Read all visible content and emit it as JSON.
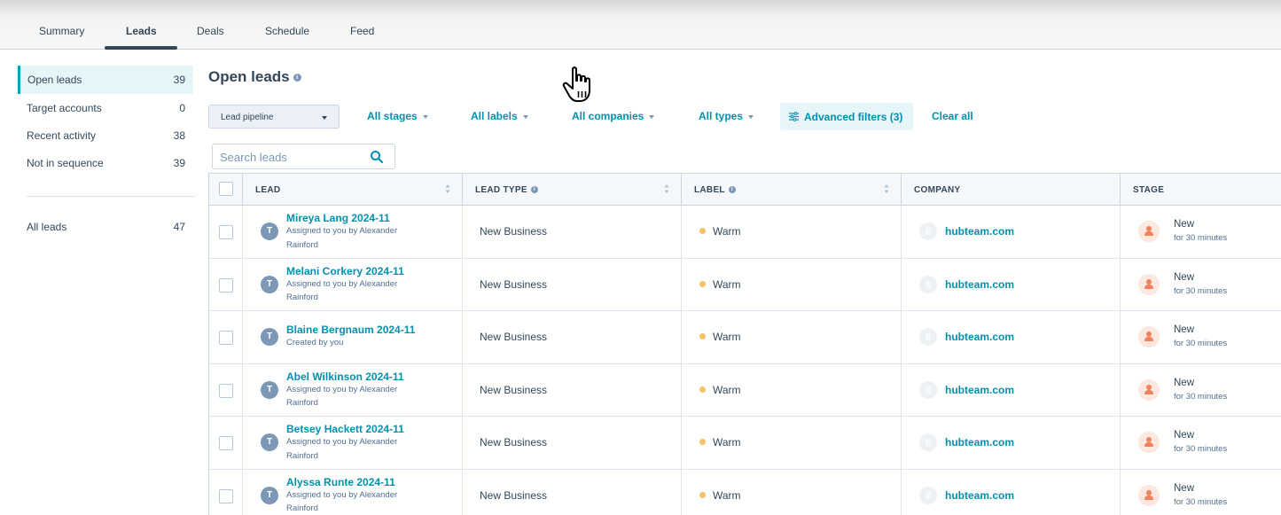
{
  "tabs": [
    {
      "label": "Summary",
      "active": false
    },
    {
      "label": "Leads",
      "active": true
    },
    {
      "label": "Deals",
      "active": false
    },
    {
      "label": "Schedule",
      "active": false
    },
    {
      "label": "Feed",
      "active": false
    }
  ],
  "sidebar": {
    "items": [
      {
        "label": "Open leads",
        "count": "39",
        "active": true
      },
      {
        "label": "Target accounts",
        "count": "0",
        "active": false
      },
      {
        "label": "Recent activity",
        "count": "38",
        "active": false
      },
      {
        "label": "Not in sequence",
        "count": "39",
        "active": false
      }
    ],
    "all_leads": {
      "label": "All leads",
      "count": "47"
    }
  },
  "main": {
    "title": "Open leads",
    "pipeline_select": "Lead pipeline",
    "filters": [
      "All stages",
      "All labels",
      "All companies",
      "All types"
    ],
    "advanced_filters": "Advanced filters (3)",
    "clear_all": "Clear all",
    "search_placeholder": "Search leads"
  },
  "table": {
    "columns": [
      "LEAD",
      "LEAD TYPE",
      "LABEL",
      "COMPANY",
      "STAGE"
    ],
    "rows": [
      {
        "avatar": "T",
        "name": "Mireya Lang 2024-11",
        "sub": "Assigned to you by Alexander Rainford",
        "type": "New Business",
        "label": "Warm",
        "company": "hubteam.com",
        "stage": "New",
        "stage_time": "for 30 minutes"
      },
      {
        "avatar": "T",
        "name": "Melani Corkery 2024-11",
        "sub": "Assigned to you by Alexander Rainford",
        "type": "New Business",
        "label": "Warm",
        "company": "hubteam.com",
        "stage": "New",
        "stage_time": "for 30 minutes"
      },
      {
        "avatar": "T",
        "name": "Blaine Bergnaum 2024-11",
        "sub": "Created by you",
        "type": "New Business",
        "label": "Warm",
        "company": "hubteam.com",
        "stage": "New",
        "stage_time": "for 30 minutes"
      },
      {
        "avatar": "T",
        "name": "Abel Wilkinson 2024-11",
        "sub": "Assigned to you by Alexander Rainford",
        "type": "New Business",
        "label": "Warm",
        "company": "hubteam.com",
        "stage": "New",
        "stage_time": "for 30 minutes"
      },
      {
        "avatar": "T",
        "name": "Betsey Hackett 2024-11",
        "sub": "Assigned to you by Alexander Rainford",
        "type": "New Business",
        "label": "Warm",
        "company": "hubteam.com",
        "stage": "New",
        "stage_time": "for 30 minutes"
      },
      {
        "avatar": "T",
        "name": "Alyssa Runte 2024-11",
        "sub": "Assigned to you by Alexander Rainford",
        "type": "New Business",
        "label": "Warm",
        "company": "hubteam.com",
        "stage": "New",
        "stage_time": "for 30 minutes"
      }
    ]
  },
  "colors": {
    "accent": "#0091ae",
    "active_bg": "#e5f5f8",
    "active_border": "#00a4bd",
    "warm_dot": "#f5c26b",
    "stage_icon": "#f0825e"
  }
}
